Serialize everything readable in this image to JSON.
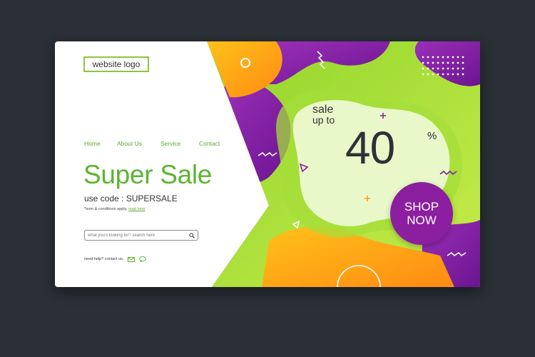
{
  "header": {
    "logo_text": "website logo"
  },
  "nav": {
    "items": [
      {
        "label": "Home"
      },
      {
        "label": "About Us"
      },
      {
        "label": "Service"
      },
      {
        "label": "Contact"
      }
    ]
  },
  "hero": {
    "headline": "Super Sale",
    "code_line": "use code : SUPERSALE",
    "terms_text": "*term & conditions apply,",
    "terms_link": "read here"
  },
  "search": {
    "placeholder": "what you's looking for? search here"
  },
  "help": {
    "text": "need help? contact us."
  },
  "promo": {
    "sale_line1": "sale",
    "sale_line2": "up to",
    "amount": "40",
    "percent": "%",
    "shop_line1": "SHOP",
    "shop_line2": "NOW"
  },
  "colors": {
    "background": "#2b2f36",
    "green": "#5cb531",
    "lime": "#c6e84a",
    "purple": "#8b1f9f",
    "orange": "#ff9f1a"
  }
}
